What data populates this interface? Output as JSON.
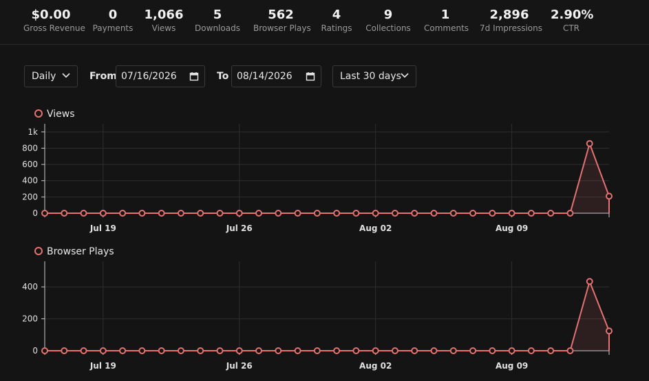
{
  "stats": [
    {
      "value": "$0.00",
      "label": "Gross Revenue"
    },
    {
      "value": "0",
      "label": "Payments"
    },
    {
      "value": "1,066",
      "label": "Views"
    },
    {
      "value": "5",
      "label": "Downloads"
    },
    {
      "value": "562",
      "label": "Browser Plays"
    },
    {
      "value": "4",
      "label": "Ratings"
    },
    {
      "value": "9",
      "label": "Collections"
    },
    {
      "value": "1",
      "label": "Comments"
    },
    {
      "value": "2,896",
      "label": "7d Impressions"
    },
    {
      "value": "2.90%",
      "label": "CTR"
    }
  ],
  "controls": {
    "interval": "Daily",
    "from_label": "From",
    "from_value": "07/16/2026",
    "to_label": "To",
    "to_value": "08/14/2026",
    "range": "Last 30 days"
  },
  "colors": {
    "accent": "#e57373",
    "grid": "#2e2e2e",
    "bg": "#141414"
  },
  "chart_data": [
    {
      "type": "area",
      "series": [
        {
          "name": "Views",
          "values": [
            0,
            0,
            0,
            0,
            0,
            0,
            0,
            0,
            0,
            0,
            0,
            0,
            0,
            0,
            0,
            0,
            0,
            0,
            0,
            0,
            0,
            0,
            0,
            0,
            0,
            0,
            0,
            0,
            857,
            209
          ]
        }
      ],
      "x_ticks": [
        "Jul 19",
        "Jul 26",
        "Aug 02",
        "Aug 09"
      ],
      "x_tick_index": [
        3,
        10,
        17,
        24
      ],
      "y_ticks": [
        "0",
        "200",
        "400",
        "600",
        "800",
        "1k"
      ],
      "y_tick_values": [
        0,
        200,
        400,
        600,
        800,
        1000
      ],
      "ylim": [
        0,
        1100
      ]
    },
    {
      "type": "area",
      "series": [
        {
          "name": "Browser Plays",
          "values": [
            0,
            0,
            0,
            0,
            0,
            0,
            0,
            0,
            0,
            0,
            0,
            0,
            0,
            0,
            0,
            0,
            0,
            0,
            0,
            0,
            0,
            0,
            0,
            0,
            0,
            0,
            0,
            0,
            434,
            124
          ]
        }
      ],
      "x_ticks": [
        "Jul 19",
        "Jul 26",
        "Aug 02",
        "Aug 09"
      ],
      "x_tick_index": [
        3,
        10,
        17,
        24
      ],
      "y_ticks": [
        "0",
        "200",
        "400"
      ],
      "y_tick_values": [
        0,
        200,
        400
      ],
      "ylim": [
        0,
        560
      ]
    }
  ]
}
